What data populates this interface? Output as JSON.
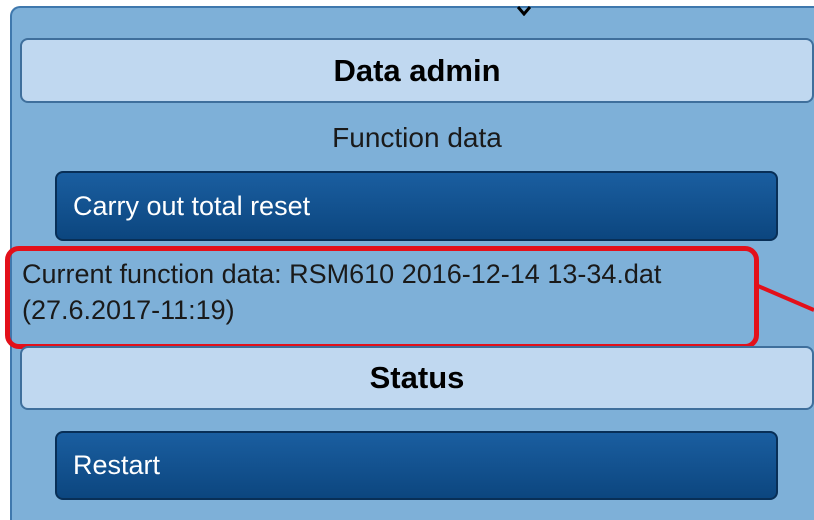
{
  "data_admin": {
    "header": "Data admin",
    "caption": "Function data",
    "reset_button_label": "Carry out total reset",
    "current_function_data_line1": "Current function data: RSM610 2016-12-14 13-34.dat",
    "current_function_data_line2": "(27.6.2017-11:19)"
  },
  "status": {
    "header": "Status",
    "restart_button_label": "Restart"
  },
  "colors": {
    "panel_background": "#7eb0d8",
    "section_header_background": "#c0d8f0",
    "button_background": "#0c467f",
    "highlight_border": "#e3101a"
  }
}
